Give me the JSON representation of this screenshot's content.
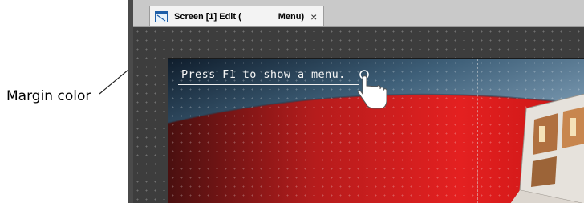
{
  "callout": {
    "label": "Margin color"
  },
  "editor": {
    "tab": {
      "title": "Screen [1] Edit (",
      "menu": "Menu)",
      "close": "×"
    }
  },
  "screen": {
    "message": "Press F1 to show a menu."
  },
  "colors": {
    "margin": "#3d3d3d",
    "tab_bar": "#c9c9c9",
    "screen_red": "#d81e1e",
    "screen_blue": "#5f7f96"
  },
  "icons": [
    "screen-edit-icon",
    "close-icon",
    "hand-pointer-icon"
  ]
}
